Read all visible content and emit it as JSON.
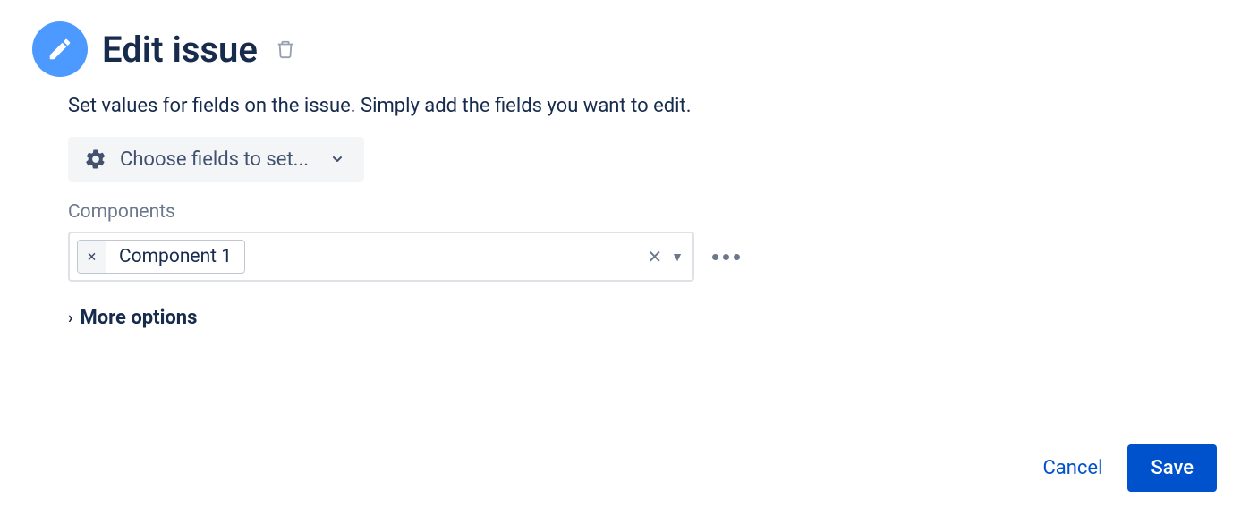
{
  "header": {
    "title": "Edit issue"
  },
  "description": "Set values for fields on the issue. Simply add the fields you want to edit.",
  "choose_fields": {
    "label": "Choose fields to set..."
  },
  "fields": {
    "components": {
      "label": "Components",
      "selected": [
        {
          "label": "Component 1"
        }
      ]
    }
  },
  "more_options": {
    "label": "More options"
  },
  "footer": {
    "cancel": "Cancel",
    "save": "Save"
  }
}
